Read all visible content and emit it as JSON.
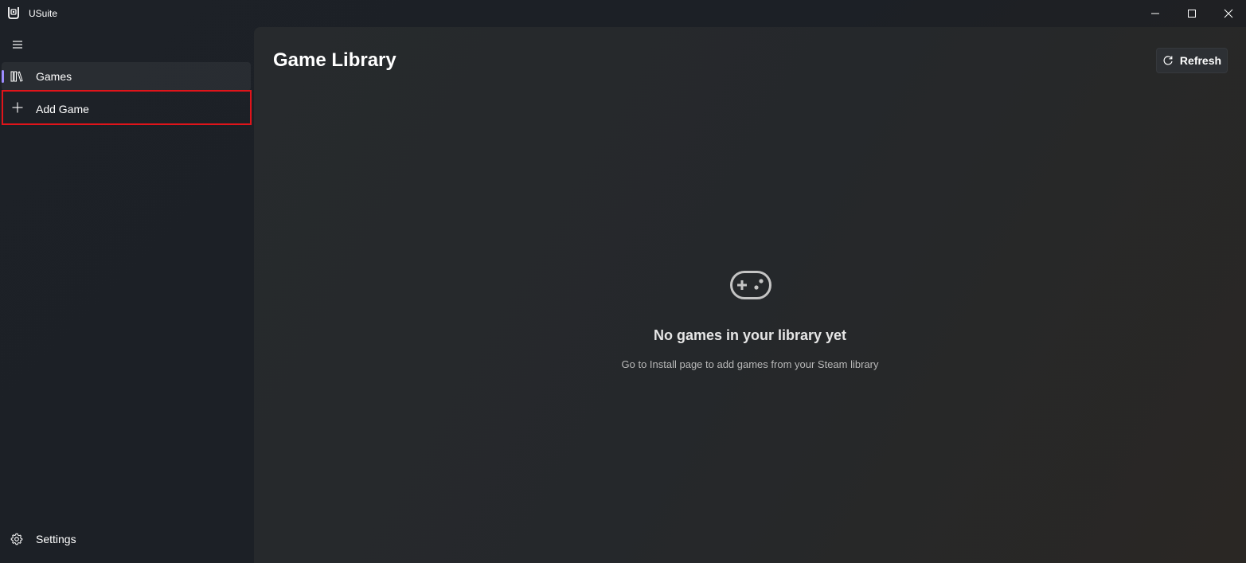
{
  "window": {
    "title": "USuite"
  },
  "sidebar": {
    "menu_icon": "hamburger-icon",
    "items": [
      {
        "label": "Games",
        "icon": "library-icon",
        "selected": true
      },
      {
        "label": "Add Game",
        "icon": "plus-icon",
        "selected": false
      }
    ],
    "footer": {
      "label": "Settings",
      "icon": "gear-icon"
    }
  },
  "main": {
    "title": "Game Library",
    "refresh_label": "Refresh",
    "refresh_icon": "refresh-icon",
    "empty_state": {
      "icon": "gamepad-icon",
      "title": "No games in your library yet",
      "subtitle": "Go to Install page to add games from your Steam library"
    }
  },
  "colors": {
    "accent": "#9d8cff",
    "highlight_border": "#e0141a"
  }
}
